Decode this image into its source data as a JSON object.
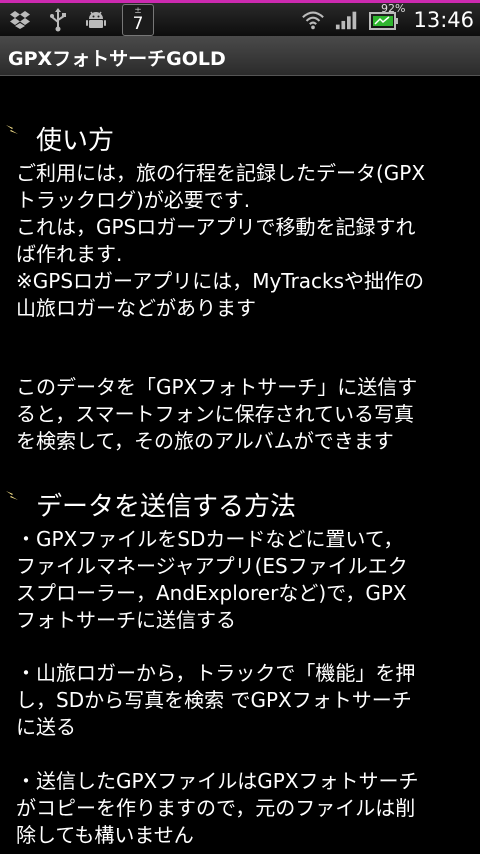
{
  "status_bar": {
    "calendar_pm": "±",
    "calendar_day": "7",
    "battery_percent": "92%",
    "time": "13:46"
  },
  "app": {
    "title": "GPXフォトサーチGOLD"
  },
  "sections": [
    {
      "heading": "使い方",
      "paragraphs": [
        "ご利用には，旅の行程を記録したデータ(GPX\nトラックログ)が必要です.\nこれは，GPSロガーアプリで移動を記録すれ\nば作れます.\n※GPSロガーアプリには，MyTracksや拙作の\n山旅ロガーなどがあります",
        "このデータを「GPXフォトサーチ」に送信す\nると，スマートフォンに保存されている写真\nを検索して，その旅のアルバムができます"
      ]
    },
    {
      "heading": "データを送信する方法",
      "paragraphs": [
        "・GPXファイルをSDカードなどに置いて，\nファイルマネージャアプリ(ESファイルエク\nスプローラー，AndExplorerなど)で，GPX\nフォトサーチに送信する",
        "・山旅ロガーから，トラックで「機能」を押\nし，SDから写真を検索 でGPXフォトサーチ\nに送る",
        "・送信したGPXファイルはGPXフォトサーチ\nがコピーを作りますので，元のファイルは削\n除しても構いません"
      ]
    }
  ]
}
